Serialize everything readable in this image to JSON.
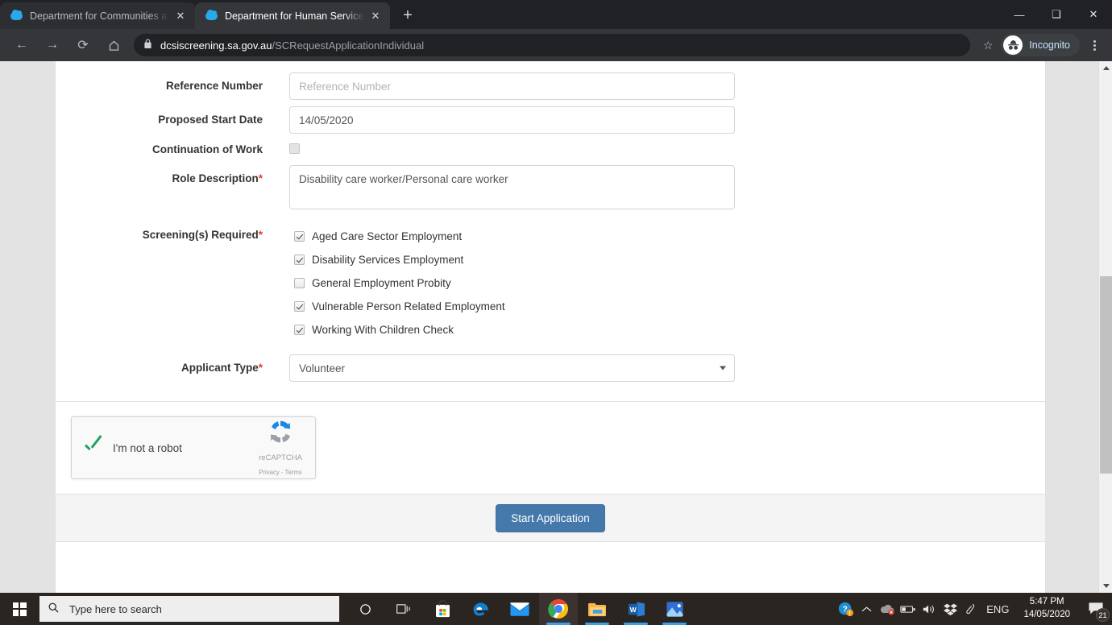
{
  "browser": {
    "tabs": [
      {
        "title": "Department for Communities and",
        "favicon": "cloud-icon",
        "active": false
      },
      {
        "title": "Department for Human Services -",
        "favicon": "cloud-icon",
        "active": true
      }
    ],
    "new_tab_label": "+",
    "window_controls": {
      "minimize": "—",
      "maximize": "❐",
      "close": "✕"
    },
    "nav": {
      "back": "←",
      "forward": "→",
      "reload": "⟳",
      "home": "⌂"
    },
    "omnibox": {
      "lock_icon": "lock-icon",
      "host": "dcsiscreening.sa.gov.au",
      "path": "/SCRequestApplicationIndividual",
      "star_icon": "star-icon"
    },
    "profile": {
      "label": "Incognito",
      "icon": "incognito-icon"
    },
    "menu_icon": "kebab-menu-icon"
  },
  "form": {
    "fields": [
      {
        "label": "Reference Number",
        "required": false,
        "type": "text",
        "value": "",
        "placeholder": "Reference Number"
      },
      {
        "label": "Proposed Start Date",
        "required": false,
        "type": "text",
        "value": "14/05/2020",
        "placeholder": ""
      },
      {
        "label": "Continuation of Work",
        "required": false,
        "type": "checkbox",
        "checked": false,
        "disabled": true
      },
      {
        "label": "Role Description",
        "required": true,
        "type": "textarea",
        "value": "Disability care worker/Personal care worker",
        "placeholder": ""
      }
    ],
    "screenings": {
      "label": "Screening(s) Required",
      "required": true,
      "options": [
        {
          "label": "Aged Care Sector Employment",
          "checked": true
        },
        {
          "label": "Disability Services Employment",
          "checked": true
        },
        {
          "label": "General Employment Probity",
          "checked": false
        },
        {
          "label": "Vulnerable Person Related Employment",
          "checked": true
        },
        {
          "label": "Working With Children Check",
          "checked": true
        }
      ]
    },
    "applicant_type": {
      "label": "Applicant Type",
      "required": true,
      "value": "Volunteer"
    }
  },
  "captcha": {
    "checkbox_state": "checked",
    "text": "I'm not a robot",
    "brand_name": "reCAPTCHA",
    "links": "Privacy - Terms"
  },
  "actions": {
    "submit_label": "Start Application",
    "submit_color": "#4679ab"
  },
  "taskbar": {
    "start_icon": "windows-logo-icon",
    "search_placeholder": "Type here to search",
    "search_icon": "search-icon",
    "pinned": [
      {
        "name": "cortana-icon",
        "glyph": "○"
      },
      {
        "name": "task-view-icon",
        "glyph": "⧉"
      },
      {
        "name": "microsoft-store-icon",
        "glyph": ""
      },
      {
        "name": "microsoft-edge-icon",
        "glyph": "e"
      },
      {
        "name": "mail-icon",
        "glyph": ""
      },
      {
        "name": "google-chrome-icon",
        "glyph": ""
      },
      {
        "name": "file-explorer-icon",
        "glyph": ""
      },
      {
        "name": "microsoft-word-icon",
        "glyph": "W"
      },
      {
        "name": "photos-icon",
        "glyph": ""
      }
    ],
    "tray": [
      {
        "name": "help-icon",
        "glyph": "?"
      },
      {
        "name": "show-hidden-icons-icon",
        "glyph": "⌃"
      },
      {
        "name": "onedrive-error-icon",
        "glyph": "☁"
      },
      {
        "name": "battery-icon",
        "glyph": "⎓"
      },
      {
        "name": "volume-icon",
        "glyph": "🔊"
      },
      {
        "name": "dropbox-icon",
        "glyph": "❖"
      },
      {
        "name": "pen-icon",
        "glyph": "✐"
      },
      {
        "name": "language-icon",
        "glyph": "ENG"
      }
    ],
    "clock": {
      "time": "5:47 PM",
      "date": "14/05/2020"
    },
    "notifications": {
      "icon": "action-center-icon",
      "count": "21"
    }
  },
  "scrollbar": {
    "up_arrow": "scroll-up-icon",
    "down_arrow": "scroll-down-icon"
  }
}
